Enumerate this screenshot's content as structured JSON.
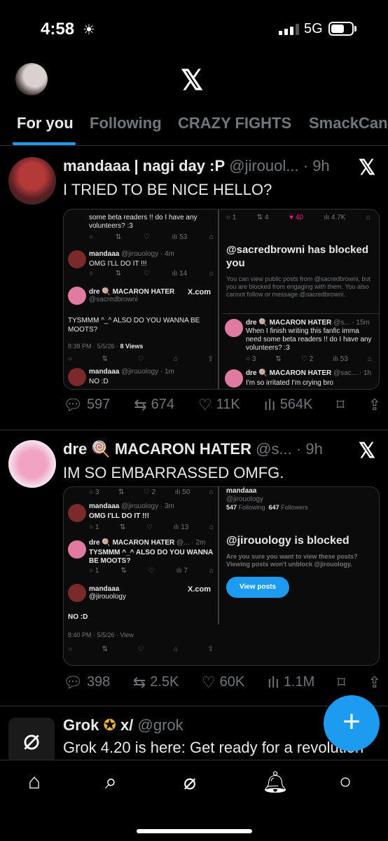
{
  "status": {
    "time": "4:58",
    "network": "5G"
  },
  "tabs": [
    "For you",
    "Following",
    "CRAZY FIGHTS",
    "SmackCan"
  ],
  "posts": [
    {
      "name": "mandaaa | nagi day :P",
      "handle": "@jirouol...",
      "age": "· 9h",
      "text": "I TRIED TO BE NICE HELLO?",
      "left": {
        "tweet1": "some beta readers !! do I have any volunteers? :3",
        "tweet1_stats": [
          "53"
        ],
        "reply_name": "mandaaa",
        "reply_handle": "@jirouology · 4m",
        "reply_text": "OMG I'LL DO IT !!!",
        "reply_stats": [
          "14"
        ],
        "main_name": "dre 🍭 MACARON HATER",
        "main_handle": "@sacredbrowni",
        "xcom": "X.com",
        "main_text": "TYSMMM ^_^ ALSO DO YOU WANNA BE MOOTS?",
        "main_meta": "8:38 PM · 5/5/26 · ",
        "main_views": "8 Views",
        "last_name": "mandaaa",
        "last_handle": "@jirouology · 1m",
        "last_text": "NO :D"
      },
      "right": {
        "top_stats": [
          "1",
          "4",
          "40",
          "4.7K"
        ],
        "blocked_title": "@sacredbrowni has blocked you",
        "blocked_body": "You can view public posts from @sacredbrowni, but you are blocked from engaging with them. You also cannot follow or message @sacredbrowni.",
        "t1_name": "dre 🍭 MACARON HATER",
        "t1_handle": "@s... · 15m",
        "t1_text": "When I finish writing this fanfic imma need some beta readers !! do I have any volunteers? :3",
        "t1_stats": [
          "3",
          "2",
          "53"
        ],
        "t2_name": "dre 🍭 MACARON HATER",
        "t2_handle": "@sac... · 1h",
        "t2_text": "I'm so irritated I'm crying bro"
      },
      "stats": {
        "replies": "597",
        "reposts": "674",
        "likes": "11K",
        "views": "564K"
      }
    },
    {
      "name": "dre 🍭 MACARON HATER",
      "handle": "@s...",
      "age": "· 9h",
      "text": "IM SO EMBARRASSED OMFG.",
      "left": {
        "top_stats": [
          "3",
          "2",
          "50"
        ],
        "reply_name": "mandaaa",
        "reply_handle": "@jirouology · 3m",
        "reply_text": "OMG I'LL DO IT !!!",
        "reply_stats": [
          "1",
          "13"
        ],
        "t2_name": "dre 🍭 MACARON HATER",
        "t2_handle": "@... · 2m",
        "t2_text": "TYSMMM ^_^ ALSO DO YOU WANNA BE MOOTS?",
        "t2_stats": [
          "1",
          "7"
        ],
        "main_name": "mandaaa",
        "main_handle": "@jirouology",
        "xcom": "X.com",
        "main_text": "NO :D",
        "main_meta": "8:40 PM · 5/5/26 · View"
      },
      "right": {
        "name": "mandaaa",
        "handle": "@jirouology",
        "following": "547",
        "following_label": "Following",
        "followers": "647",
        "followers_label": "Followers",
        "blocked_title": "@jirouology is blocked",
        "blocked_body": "Are you sure you want to view these posts? Viewing posts won't unblock @jirouology.",
        "button": "View posts"
      },
      "stats": {
        "replies": "398",
        "reposts": "2.5K",
        "likes": "60K",
        "views": "1.1M"
      }
    },
    {
      "name": "Grok",
      "handle": "@grok",
      "text": "Grok 4.20 is here: Get ready for a revolution"
    }
  ],
  "icons": {
    "reply": "speech-bubble",
    "repost": "repost-arrows",
    "like": "heart",
    "views": "bar-chart",
    "bookmark": "bookmark",
    "share": "share-up-arrow"
  },
  "colors": {
    "accent": "#1d9bf0",
    "background": "#000000",
    "muted": "#71767b"
  }
}
